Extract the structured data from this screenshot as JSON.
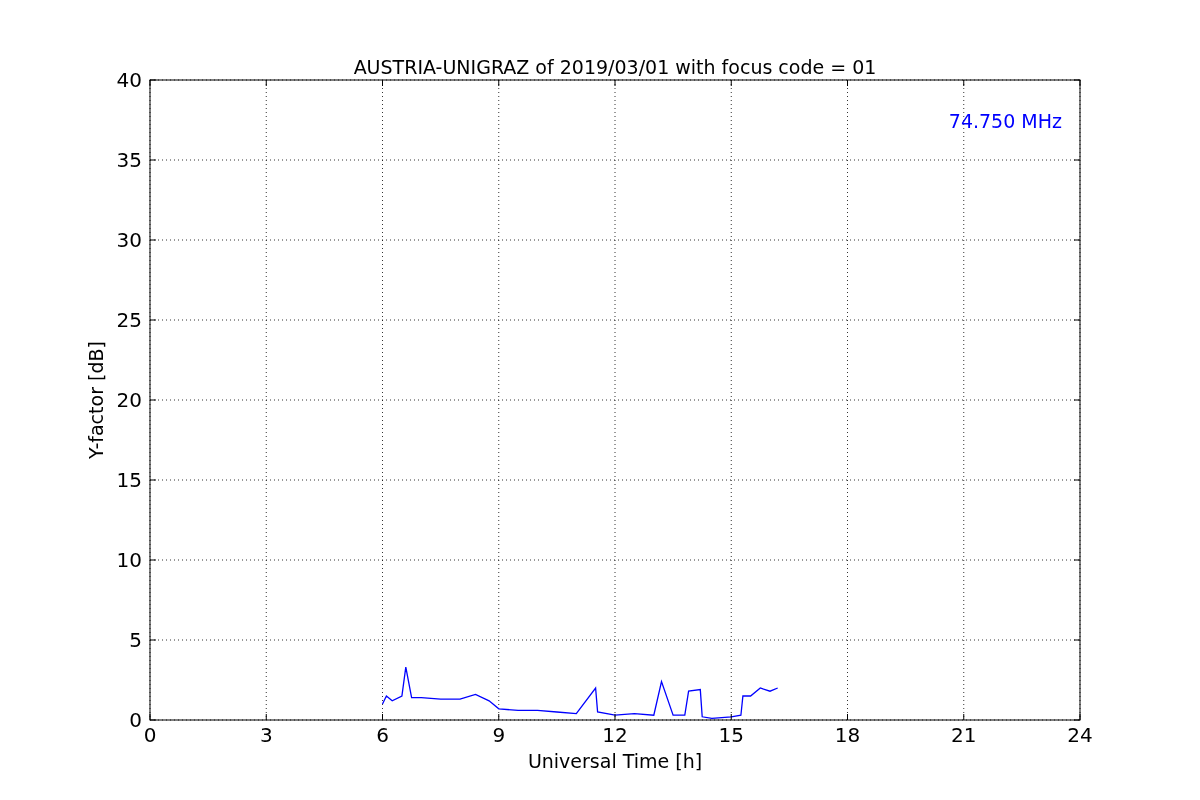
{
  "chart_data": {
    "type": "line",
    "title": "AUSTRIA-UNIGRAZ of 2019/03/01 with focus code = 01",
    "xlabel": "Universal Time [h]",
    "ylabel": "Y-factor [dB]",
    "x": [
      6.0,
      6.1,
      6.25,
      6.5,
      6.6,
      6.75,
      7.0,
      7.5,
      8.0,
      8.4,
      8.75,
      9.0,
      9.5,
      10.0,
      10.5,
      11.0,
      11.5,
      11.55,
      12.0,
      12.5,
      13.0,
      13.2,
      13.5,
      13.8,
      13.9,
      14.2,
      14.25,
      14.5,
      15.0,
      15.25,
      15.3,
      15.5,
      15.75,
      16.0,
      16.2
    ],
    "series": [
      {
        "name": "74.750 MHz",
        "color": "#0000ff",
        "values": [
          1.0,
          1.5,
          1.2,
          1.5,
          3.3,
          1.4,
          1.4,
          1.3,
          1.3,
          1.6,
          1.2,
          0.7,
          0.6,
          0.6,
          0.5,
          0.4,
          2.0,
          0.5,
          0.3,
          0.4,
          0.3,
          2.4,
          0.3,
          0.3,
          1.8,
          1.9,
          0.2,
          0.1,
          0.2,
          0.3,
          1.5,
          1.5,
          2.0,
          1.8,
          2.0
        ]
      }
    ],
    "xlim": [
      0,
      24
    ],
    "ylim": [
      0,
      40
    ],
    "xticks": [
      0,
      3,
      6,
      9,
      12,
      15,
      18,
      21,
      24
    ],
    "yticks": [
      0,
      5,
      10,
      15,
      20,
      25,
      30,
      35,
      40
    ],
    "grid": true
  }
}
